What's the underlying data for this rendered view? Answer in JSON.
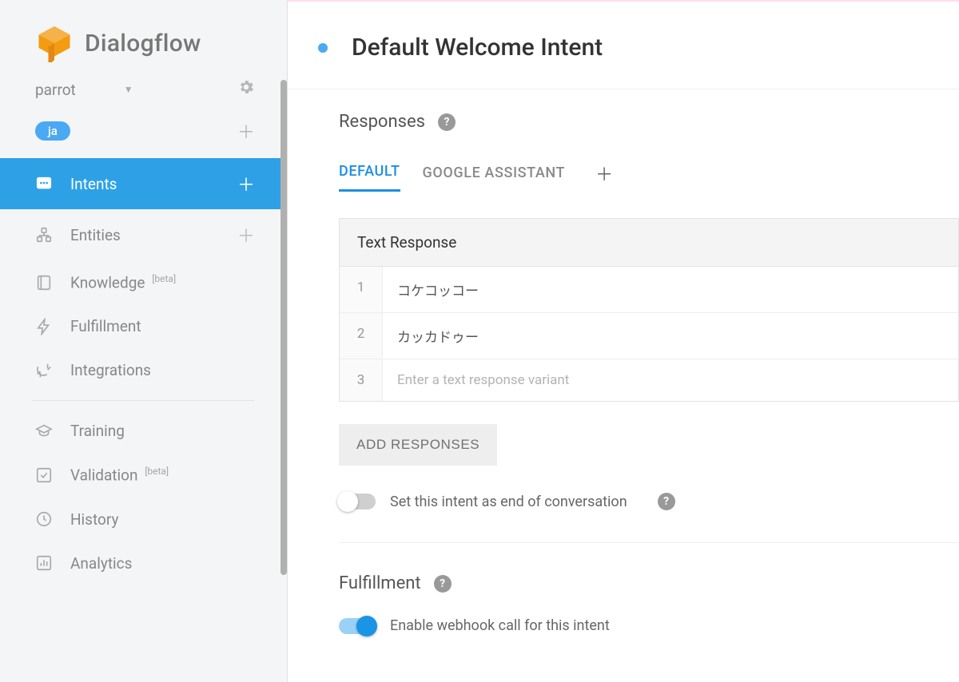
{
  "brand": {
    "name": "Dialogflow"
  },
  "agent": {
    "name": "parrot",
    "language": "ja"
  },
  "sidebar": {
    "items": [
      {
        "id": "intents",
        "label": "Intents",
        "add": true
      },
      {
        "id": "entities",
        "label": "Entities",
        "add": true
      },
      {
        "id": "knowledge",
        "label": "Knowledge",
        "beta": "[beta]"
      },
      {
        "id": "fulfillment",
        "label": "Fulfillment"
      },
      {
        "id": "integrations",
        "label": "Integrations"
      },
      {
        "id": "training",
        "label": "Training"
      },
      {
        "id": "validation",
        "label": "Validation",
        "beta": "[beta]"
      },
      {
        "id": "history",
        "label": "History"
      },
      {
        "id": "analytics",
        "label": "Analytics"
      }
    ]
  },
  "intent": {
    "title": "Default Welcome Intent",
    "responses_heading": "Responses",
    "tabs": {
      "default": "DEFAULT",
      "assistant": "GOOGLE ASSISTANT"
    },
    "text_response_heading": "Text Response",
    "responses": [
      "コケコッコー",
      "カッカドゥー"
    ],
    "response_placeholder": "Enter a text response variant",
    "add_responses_label": "ADD RESPONSES",
    "end_conversation_label": "Set this intent as end of conversation"
  },
  "fulfillment_section": {
    "heading": "Fulfillment",
    "enable_webhook_label": "Enable webhook call for this intent"
  }
}
